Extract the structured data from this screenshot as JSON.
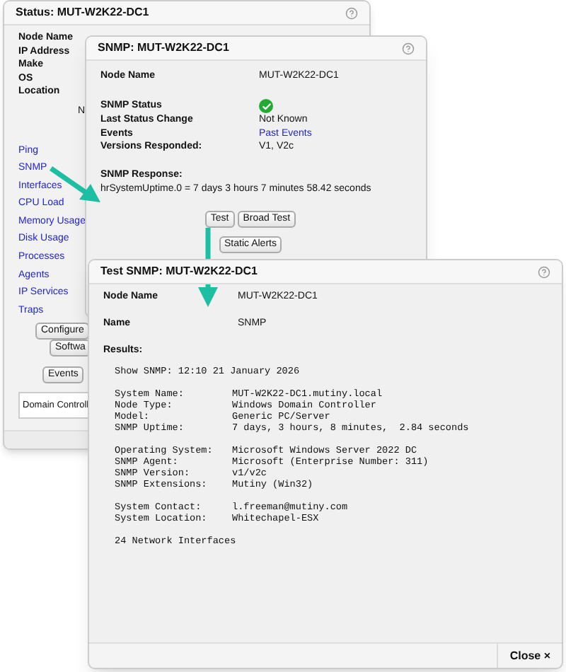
{
  "status_window": {
    "title": "Status: MUT-W2K22-DC1",
    "fields": [
      "Node Name",
      "IP Address",
      "Make",
      "OS",
      "Location"
    ],
    "partial_text": "N",
    "links": [
      "Ping",
      "SNMP",
      "Interfaces",
      "CPU Load",
      "Memory Usage",
      "Disk Usage",
      "Processes",
      "Agents",
      "IP Services",
      "Traps"
    ],
    "buttons": [
      "Configure",
      "Softwa",
      "Events"
    ],
    "domain_box": "Domain Controll"
  },
  "snmp_window": {
    "title": "SNMP: MUT-W2K22-DC1",
    "node_label": "Node Name",
    "node_value": "MUT-W2K22-DC1",
    "rows": [
      {
        "kind": "status",
        "label": "SNMP Status",
        "ok": true
      },
      {
        "kind": "text",
        "label": "Last Status Change",
        "value": "Not Known"
      },
      {
        "kind": "link",
        "label": "Events",
        "value": "Past Events"
      },
      {
        "kind": "text",
        "label": "Versions Responded:",
        "value": "V1, V2c"
      }
    ],
    "response_label": "SNMP Response:",
    "response": "hrSystemUptime.0 = 7 days 3 hours 7 minutes 58.42 seconds",
    "buttons": [
      "Test",
      "Broad Test"
    ],
    "extra_button": "Static Alerts"
  },
  "test_window": {
    "title": "Test SNMP: MUT-W2K22-DC1",
    "fields": [
      {
        "label": "Node Name",
        "value": "MUT-W2K22-DC1"
      },
      {
        "label": "Name",
        "value": "SNMP"
      }
    ],
    "results_label": "Results:",
    "show_line": "Show SNMP: 12:10 21 January 2026",
    "groups": [
      [
        {
          "label": "System Name:",
          "value": "MUT-W2K22-DC1.mutiny.local"
        },
        {
          "label": "Node Type:",
          "value": "Windows Domain Controller"
        },
        {
          "label": "Model:",
          "value": "Generic PC/Server"
        },
        {
          "label": "SNMP Uptime:",
          "value": "7 days, 3 hours, 8 minutes,  2.84 seconds"
        }
      ],
      [
        {
          "label": "Operating System:",
          "value": "Microsoft Windows Server 2022 DC"
        },
        {
          "label": "SNMP Agent:",
          "value": "Microsoft (Enterprise Number: 311)"
        },
        {
          "label": "SNMP Version:",
          "value": "v1/v2c"
        },
        {
          "label": "SNMP Extensions:",
          "value": "Mutiny (Win32)"
        }
      ],
      [
        {
          "label": "System Contact:",
          "value": "l.freeman@mutiny.com"
        },
        {
          "label": "System Location:",
          "value": "Whitechapel-ESX"
        }
      ]
    ],
    "summary": "24 Network Interfaces",
    "close_button": "Close ×"
  }
}
